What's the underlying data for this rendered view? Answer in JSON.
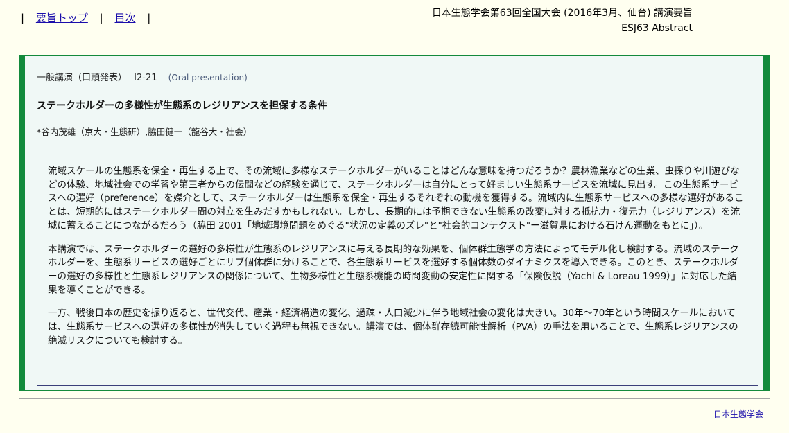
{
  "nav": {
    "left_bar": "|",
    "link_top": "要旨トップ",
    "mid_bar": "|",
    "link_toc": "目次",
    "right_bar": "|"
  },
  "conference": {
    "line1": "日本生態学会第63回全国大会 (2016年3月、仙台) 講演要旨",
    "line2": "ESJ63 Abstract"
  },
  "abstract": {
    "session": "一般講演（口頭発表）",
    "code": "I2-21",
    "oral": "(Oral presentation)",
    "title": "ステークホルダーの多様性が生態系のレジリアンスを担保する条件",
    "authors": "*谷内茂雄（京大・生態研）,脇田健一（龍谷大・社会）",
    "paragraphs": [
      "流域スケールの生態系を保全・再生する上で、その流域に多様なステークホルダーがいることはどんな意味を持つだろうか？農林漁業などの生業、虫採りや川遊びなどの体験、地域社会での学習や第三者からの伝聞などの経験を通じて、ステークホルダーは自分にとって好ましい生態系サービスを流域に見出す。この生態系サービスへの選好（preference）を媒介として、ステークホルダーは生態系を保全・再生するそれぞれの動機を獲得する。流域内に生態系サービスへの多様な選好があることは、短期的にはステークホルダー間の対立を生みだすかもしれない。しかし、長期的には予期できない生態系の改変に対する抵抗力・復元力（レジリアンス）を流域に蓄えることにつながるだろう（脇田 2001「地域環境問題をめぐる\"状況の定義のズレ\"と\"社会的コンテクスト\"ー滋賀県における石けん運動をもとに」）。",
      "本講演では、ステークホルダーの選好の多様性が生態系のレジリアンスに与える長期的な効果を、個体群生態学の方法によってモデル化し検討する。流域のステークホルダーを、生態系サービスの選好ごとにサブ個体群に分けることで、各生態系サービスを選好する個体数のダイナミクスを導入できる。このとき、ステークホルダーの選好の多様性と生態系レジリアンスの関係について、生物多様性と生態系機能の時間変動の安定性に関する「保険仮説（Yachi & Loreau 1999）」に対応した結果を導くことができる。",
      "一方、戦後日本の歴史を振り返ると、世代交代、産業・経済構造の変化、過疎・人口減少に伴う地域社会の変化は大きい。30年〜70年という時間スケールにおいては、生態系サービスへの選好の多様性が消失していく過程も無視できない。講演では、個体群存続可能性解析（PVA）の手法を用いることで、生態系レジリアンスの絶滅リスクについても検討する。"
    ]
  },
  "footer": {
    "link": "日本生態学会"
  }
}
